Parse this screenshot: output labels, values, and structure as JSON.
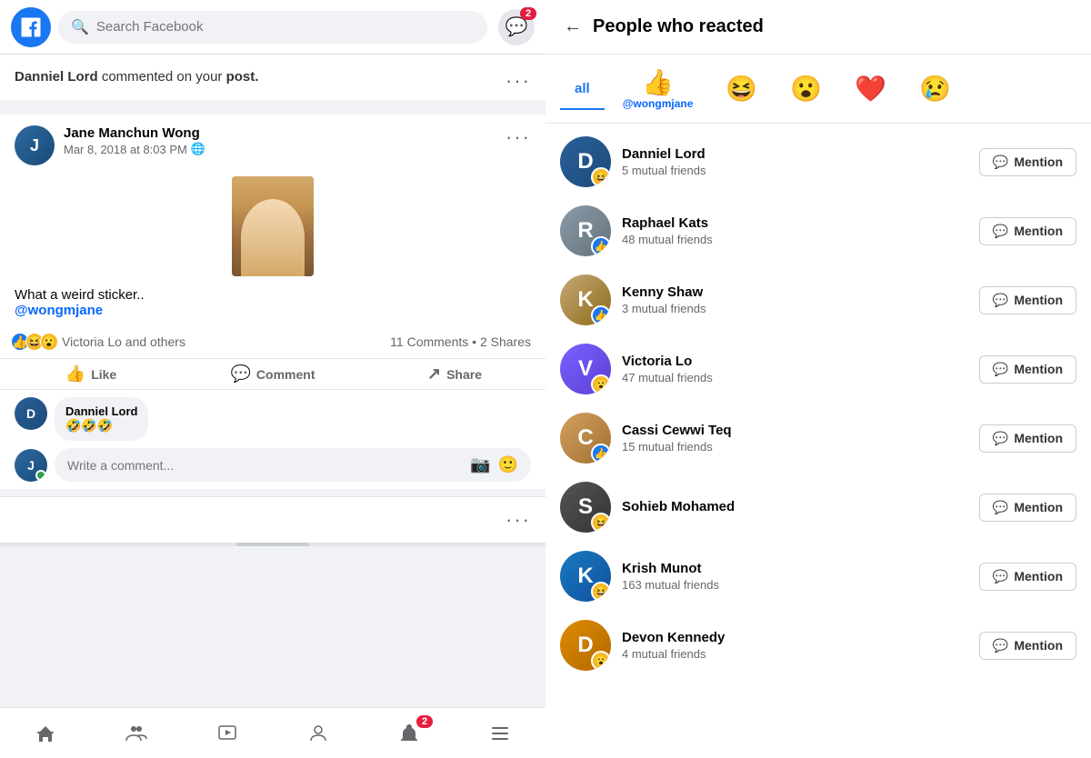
{
  "app": {
    "name": "Facebook"
  },
  "header": {
    "search_placeholder": "Search Facebook",
    "messenger_badge": "2"
  },
  "notification": {
    "user": "Danniel Lord",
    "action": "commented on your",
    "target": "post."
  },
  "post": {
    "author": "Jane Manchun Wong",
    "time": "Mar 8, 2018 at 8:03 PM",
    "text": "What a weird sticker..",
    "mention": "@wongmjane",
    "reactions_label": "Victoria Lo and others",
    "comments_count": "11 Comments",
    "shares_count": "2 Shares",
    "like_label": "Like",
    "comment_label": "Comment",
    "share_label": "Share"
  },
  "comment": {
    "author": "Danniel Lord",
    "text": "🤣🤣🤣",
    "input_placeholder": "Write a comment..."
  },
  "right_panel": {
    "title": "People who reacted",
    "tabs": [
      {
        "id": "all",
        "label": "All",
        "emoji": "",
        "active": true
      },
      {
        "id": "like",
        "label": "",
        "emoji": "👍",
        "active": false
      },
      {
        "id": "haha",
        "label": "",
        "emoji": "😆",
        "active": false
      },
      {
        "id": "wow",
        "label": "",
        "emoji": "😮",
        "active": false
      },
      {
        "id": "heart",
        "label": "",
        "emoji": "❤️",
        "active": false
      },
      {
        "id": "sad",
        "label": "",
        "emoji": "😢",
        "active": false
      }
    ],
    "mention_tag": "@wongmjane",
    "people": [
      {
        "name": "Danniel Lord",
        "mutual": "5 mutual friends",
        "reaction": "😆",
        "reaction_type": "haha"
      },
      {
        "name": "Raphael Kats",
        "mutual": "48 mutual friends",
        "reaction": "👍",
        "reaction_type": "like"
      },
      {
        "name": "Kenny Shaw",
        "mutual": "3 mutual friends",
        "reaction": "👍",
        "reaction_type": "like"
      },
      {
        "name": "Victoria Lo",
        "mutual": "47 mutual friends",
        "reaction": "😮",
        "reaction_type": "wow"
      },
      {
        "name": "Cassi Cewwi Teq",
        "mutual": "15 mutual friends",
        "reaction": "👍",
        "reaction_type": "like"
      },
      {
        "name": "Sohieb Mohamed",
        "mutual": "",
        "reaction": "😆",
        "reaction_type": "haha"
      },
      {
        "name": "Krish Munot",
        "mutual": "163 mutual friends",
        "reaction": "😆",
        "reaction_type": "haha"
      },
      {
        "name": "Devon Kennedy",
        "mutual": "4 mutual friends",
        "reaction": "😮",
        "reaction_type": "wow"
      }
    ],
    "mention_button_label": "Mention"
  },
  "bottom_nav": {
    "items": [
      "home",
      "friends",
      "watch",
      "profile",
      "notifications",
      "menu"
    ]
  },
  "icons": {
    "search": "🔍",
    "messenger": "💬",
    "back": "←",
    "comment_icon": "💬",
    "camera": "📷",
    "emoji": "🙂",
    "like_thumb": "👍",
    "share_arrow": "↗",
    "globe": "🌐"
  }
}
